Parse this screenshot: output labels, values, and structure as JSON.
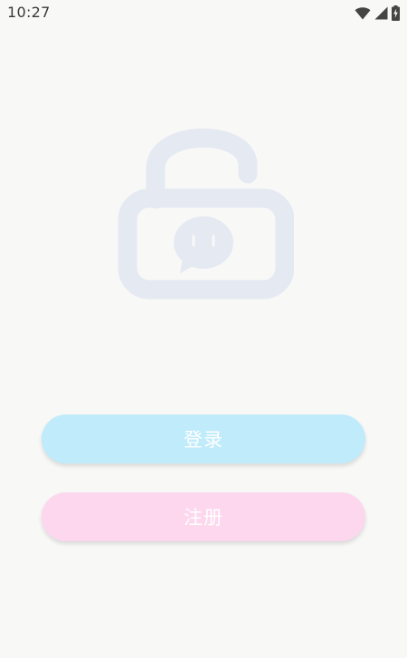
{
  "status_bar": {
    "time": "10:27",
    "icons": [
      "wifi-icon",
      "cellular-signal-icon",
      "battery-charging-icon"
    ]
  },
  "hero": {
    "icon": "unlocked-padlock-chat-icon",
    "color": "#e5e9f2"
  },
  "buttons": {
    "login_label": "登录",
    "register_label": "注册"
  },
  "colors": {
    "background": "#f8f8f7",
    "login_button": "#bfebfb",
    "register_button": "#fcd7ee",
    "button_text": "#ffffff"
  }
}
